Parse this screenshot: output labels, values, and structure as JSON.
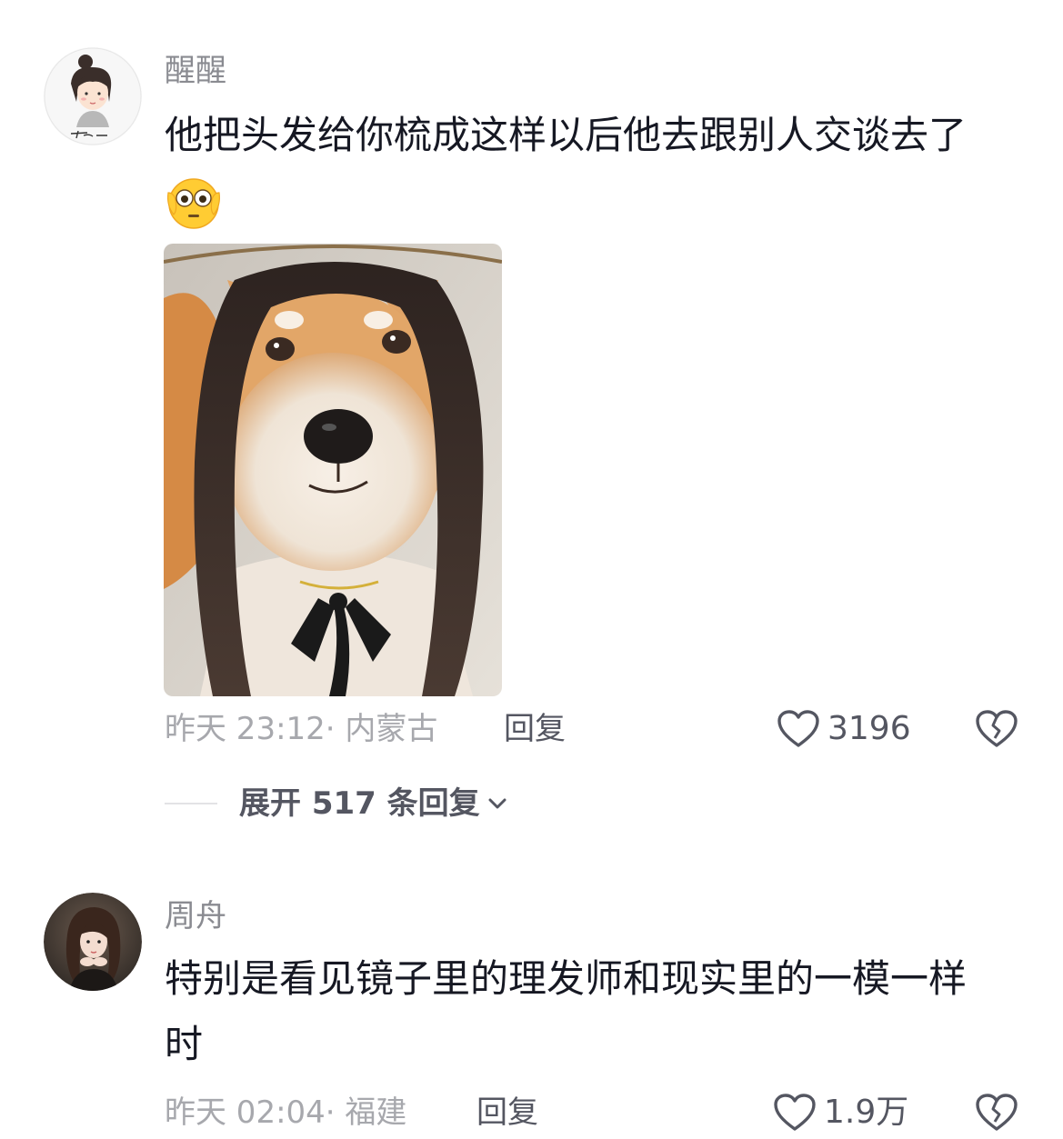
{
  "comments": [
    {
      "username": "醒醒",
      "text": "他把头发给你梳成这样以后他去跟别人交谈去了",
      "emoji": "flushed-face-emoji",
      "image": "shiba-dog-with-long-hair-wig-photo",
      "time": "昨天 23:12",
      "location": "· 内蒙古",
      "reply_label": "回复",
      "like_count": "3196",
      "expand_label": "展开 517 条回复"
    },
    {
      "username": "周舟",
      "text_line1": "特别是看见镜子里的理发师和现实里的一模一样",
      "text_line2": "时",
      "time": "昨天 02:04",
      "location": "· 福建",
      "reply_label": "回复",
      "like_count": "1.9万"
    }
  ],
  "colors": {
    "primary_text": "#161823",
    "username": "#8a8b91",
    "meta": "#a7a8ad",
    "action": "#545661"
  }
}
